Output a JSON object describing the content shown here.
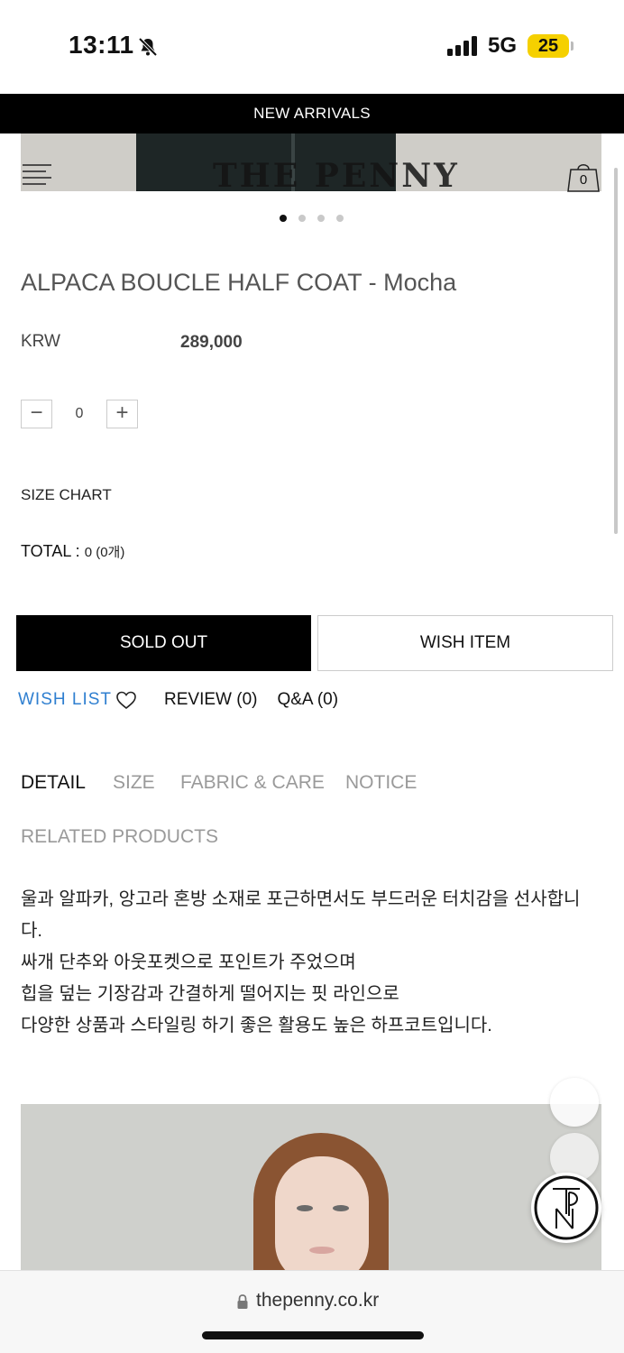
{
  "status_bar": {
    "time": "13:11",
    "network": "5G",
    "battery": "25"
  },
  "banner": {
    "label": "NEW ARRIVALS"
  },
  "header": {
    "logo": "THE PENNY",
    "cart_count": "0"
  },
  "carousel": {
    "total": 4,
    "active": 1
  },
  "product": {
    "title": "ALPACA BOUCLE HALF COAT - Mocha",
    "currency": "KRW",
    "price": "289,000",
    "quantity": "0",
    "minus_label": "−",
    "plus_label": "+",
    "size_chart": "SIZE CHART",
    "total_label": "TOTAL : ",
    "total_value": "0 (0개)"
  },
  "actions": {
    "sold_out": "SOLD OUT",
    "wish_item": "WISH ITEM",
    "wish_list": "WISH LIST",
    "review": "REVIEW (0)",
    "qa": "Q&A (0)"
  },
  "tabs": [
    {
      "label": "DETAIL",
      "active": true
    },
    {
      "label": "SIZE",
      "active": false
    },
    {
      "label": "FABRIC & CARE",
      "active": false
    },
    {
      "label": "NOTICE",
      "active": false
    },
    {
      "label": "RELATED PRODUCTS",
      "active": false
    }
  ],
  "description": [
    "울과 알파카, 앙고라 혼방 소재로 포근하면서도 부드러운 터치감을 선사합니",
    "다.",
    "싸개 단추와 아웃포켓으로 포인트가 주었으며",
    "힙을 덮는 기장감과 간결하게 떨어지는 핏 라인으로",
    "다양한 상품과 스타일링 하기 좋은 활용도 높은 하프코트입니다."
  ],
  "browser": {
    "url": "thepenny.co.kr"
  },
  "colors": {
    "accent_link": "#2f7fd0",
    "battery": "#f5d000"
  }
}
